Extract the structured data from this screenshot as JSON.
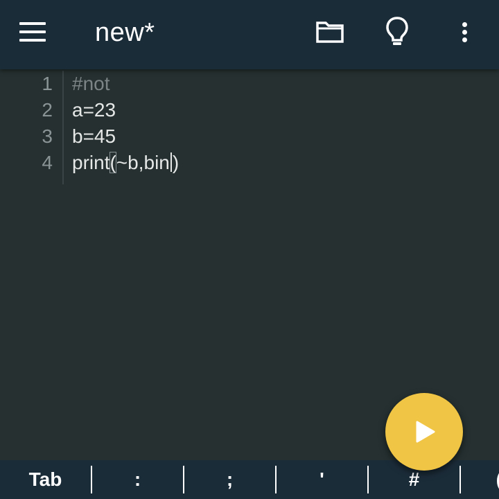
{
  "appbar": {
    "title": "new*",
    "menu_icon": "hamburger-menu-icon",
    "folder_icon": "folder-icon",
    "bulb_icon": "lightbulb-icon",
    "more_icon": "more-vertical-icon"
  },
  "editor": {
    "lines": [
      {
        "number": "1",
        "text": "#not"
      },
      {
        "number": "2",
        "text": "a=23"
      },
      {
        "number": "3",
        "text": "b=45"
      },
      {
        "number": "4",
        "prefix": "print",
        "open": "(",
        "middle": "~b,bin",
        "close": ")"
      }
    ]
  },
  "run_button": {
    "icon": "play-icon"
  },
  "keybar": {
    "keys": [
      "Tab",
      ":",
      ";",
      "'",
      "#",
      "("
    ]
  },
  "colors": {
    "background": "#263030",
    "toolbar": "#1b2c39",
    "fab": "#f0c444",
    "code_text": "#e6e8e8",
    "comment": "#7c8486",
    "line_numbers": "#8a9496"
  }
}
